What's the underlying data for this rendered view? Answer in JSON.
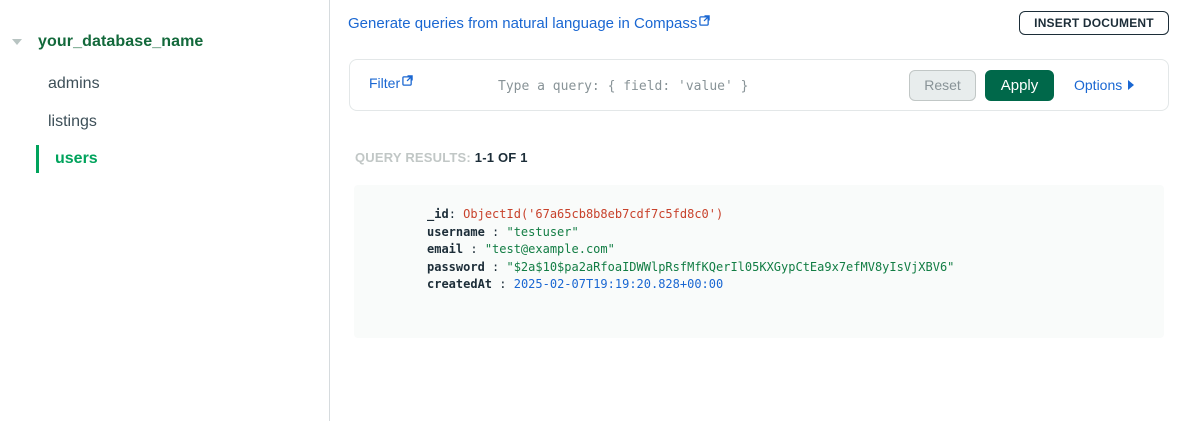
{
  "sidebar": {
    "database": "your_database_name",
    "collections": [
      {
        "label": "admins"
      },
      {
        "label": "listings"
      },
      {
        "label": "users"
      }
    ],
    "active_collection": "users"
  },
  "main": {
    "generate_link": "Generate queries from natural language in Compass",
    "insert_button": "INSERT DOCUMENT",
    "query_bar": {
      "filter_label": "Filter",
      "placeholder": "Type a query: { field: 'value' }",
      "reset_label": "Reset",
      "apply_label": "Apply",
      "options_label": "Options"
    },
    "results": {
      "label": "QUERY RESULTS: ",
      "count": "1-1 OF 1"
    },
    "document": {
      "id_key": "_id",
      "id_value": "ObjectId('67a65cb8b8eb7cdf7c5fd8c0')",
      "username_key": "username",
      "username_value": "\"testuser\"",
      "email_key": "email",
      "email_value": "\"test@example.com\"",
      "password_key": "password",
      "password_value": "\"$2a$10$pa2aRfoaIDWWlpRsfMfKQerIl05KXGypCtEa9x7efMV8yIsVjXBV6\"",
      "createdAt_key": "createdAt",
      "createdAt_value": "2025-02-07T19:19:20.828+00:00"
    }
  },
  "colors": {
    "accent_green": "#00a35c",
    "dark_green": "#00684a",
    "link_blue": "#1a67d2"
  }
}
